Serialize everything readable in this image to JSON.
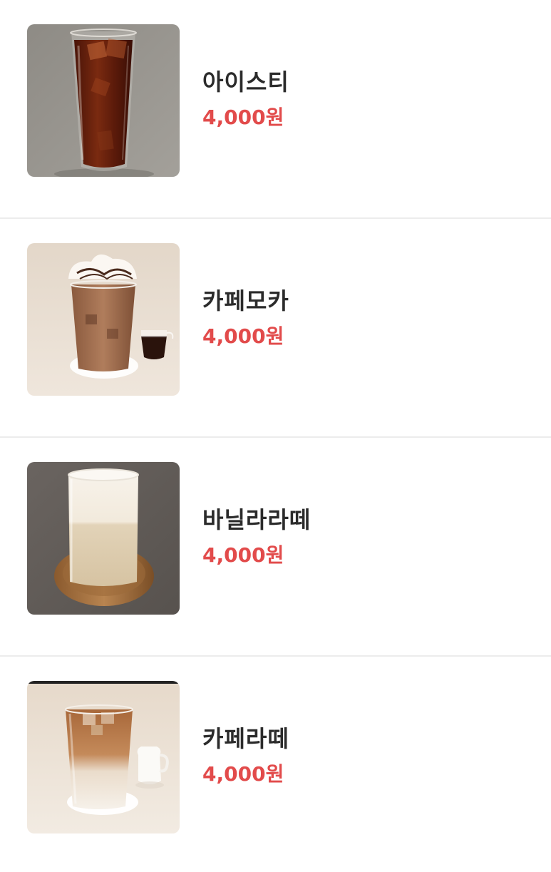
{
  "menu": {
    "items": [
      {
        "name": "아이스티",
        "price": "4,000원",
        "image": "iced-tea-image"
      },
      {
        "name": "카페모카",
        "price": "4,000원",
        "image": "cafe-mocha-image"
      },
      {
        "name": "바닐라라떼",
        "price": "4,000원",
        "image": "vanilla-latte-image"
      },
      {
        "name": "카페라떼",
        "price": "4,000원",
        "image": "cafe-latte-image"
      }
    ]
  },
  "colors": {
    "price": "#e24b4b",
    "name": "#2b2b2b",
    "divider": "#ececec"
  }
}
